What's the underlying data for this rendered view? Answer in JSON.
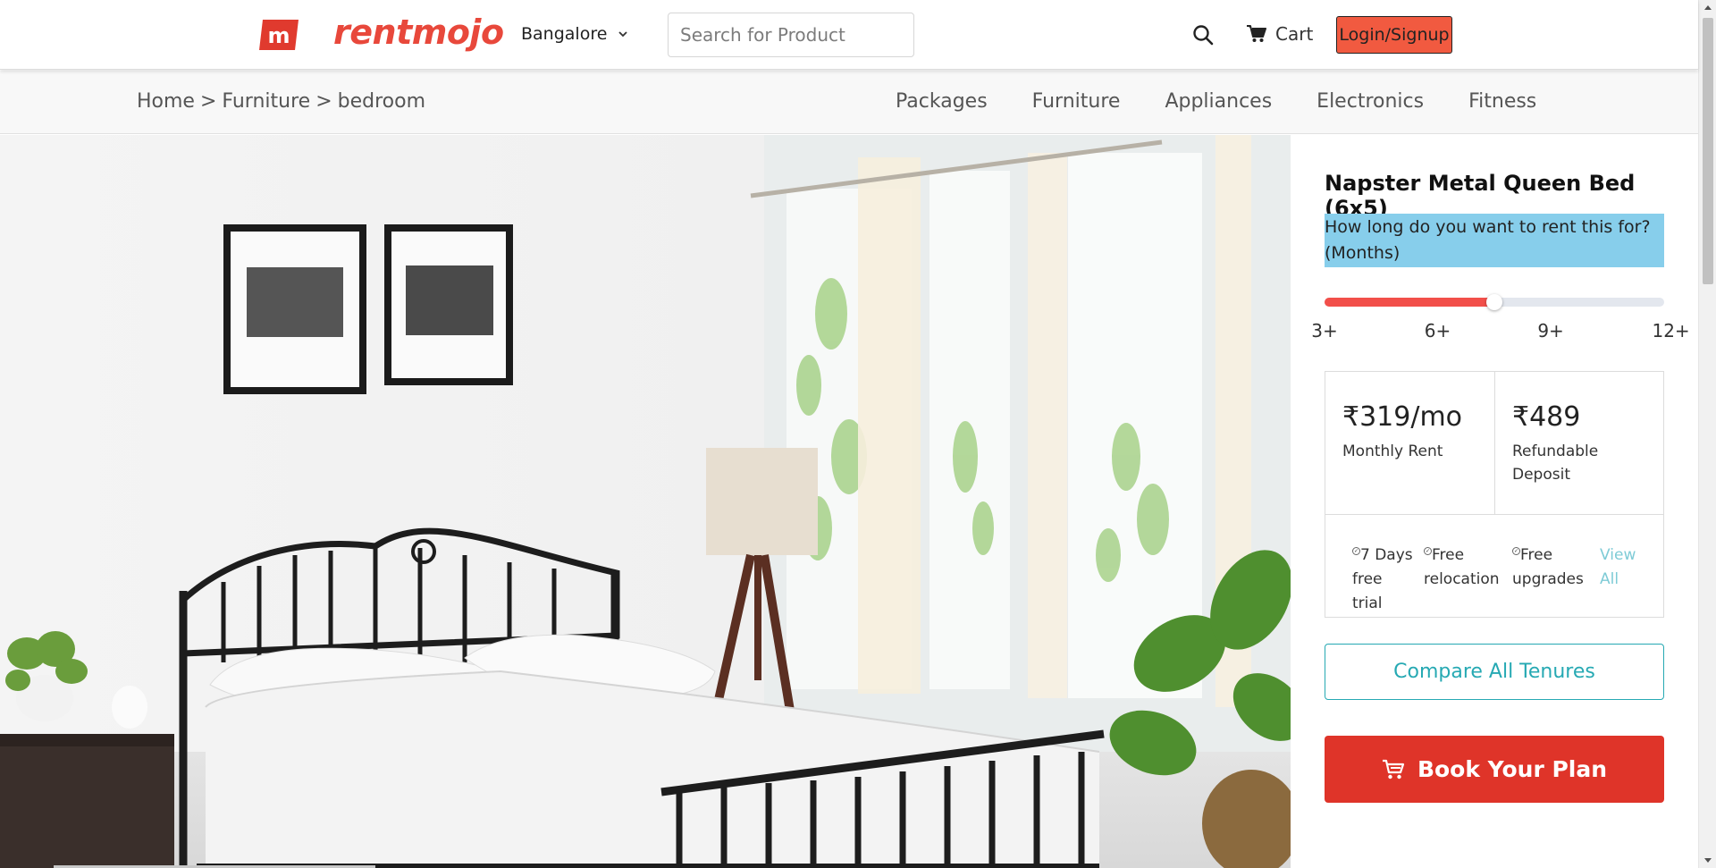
{
  "header": {
    "logo_text": "rentmojo",
    "city": "Bangalore",
    "search_placeholder": "Search for Product",
    "cart_label": "Cart",
    "login_label": "Login/Signup"
  },
  "breadcrumb": [
    "Home",
    "Furniture",
    "bedroom"
  ],
  "breadcrumb_separator": ">",
  "nav": [
    "Packages",
    "Furniture",
    "Appliances",
    "Electronics",
    "Fitness"
  ],
  "product": {
    "title": "Napster Metal Queen Bed (6x5)",
    "tenure_question": "How long do you want to rent this for? (Months)",
    "tenure_ticks": [
      "3+",
      "6+",
      "9+",
      "12+"
    ],
    "tenure_selected_fraction": 0.5,
    "monthly_rent": "₹319/mo",
    "monthly_rent_label": "Monthly Rent",
    "deposit": "₹489",
    "deposit_label": "Refundable Deposit",
    "benefits": [
      "7 Days free trial",
      "Free relocation",
      "Free upgrades"
    ],
    "view_all": "View All",
    "compare_label": "Compare All Tenures",
    "book_label": "Book Your Plan"
  },
  "colors": {
    "brand": "#e8483b",
    "login_bg": "#f15a40",
    "slider_fill": "#f24f4a",
    "question_bg": "#87ceeb",
    "teal": "#26a9b3",
    "book_bg": "#df3429"
  },
  "icons": [
    "rentmojo-logo-icon",
    "chevron-down-icon",
    "search-icon",
    "cart-icon",
    "check-circle-icon",
    "cart-outline-icon"
  ]
}
